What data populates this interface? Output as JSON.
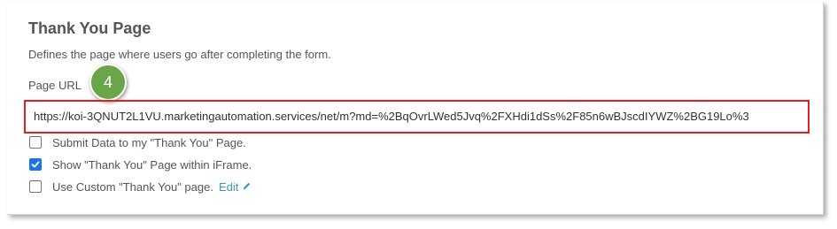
{
  "section": {
    "title": "Thank You Page",
    "description": "Defines the page where users go after completing the form."
  },
  "page_url": {
    "label": "Page URL",
    "value": "https://koi-3QNUT2L1VU.marketingautomation.services/net/m?md=%2BqOvrLWed5Jvq%2FXHdi1dSs%2F85n6wBJscdIYWZ%2BG19Lo%3"
  },
  "annotation": {
    "step_number": "4",
    "badge_color": "#6aa54a",
    "highlight_color": "#e02020"
  },
  "options": [
    {
      "label": "Submit Data to my \"Thank You\" Page.",
      "checked": false
    },
    {
      "label": "Show \"Thank You\" Page within iFrame.",
      "checked": true
    },
    {
      "label": "Use Custom \"Thank You\" page.",
      "checked": false
    }
  ],
  "edit_link": {
    "label": "Edit",
    "icon": "pencil-icon"
  }
}
